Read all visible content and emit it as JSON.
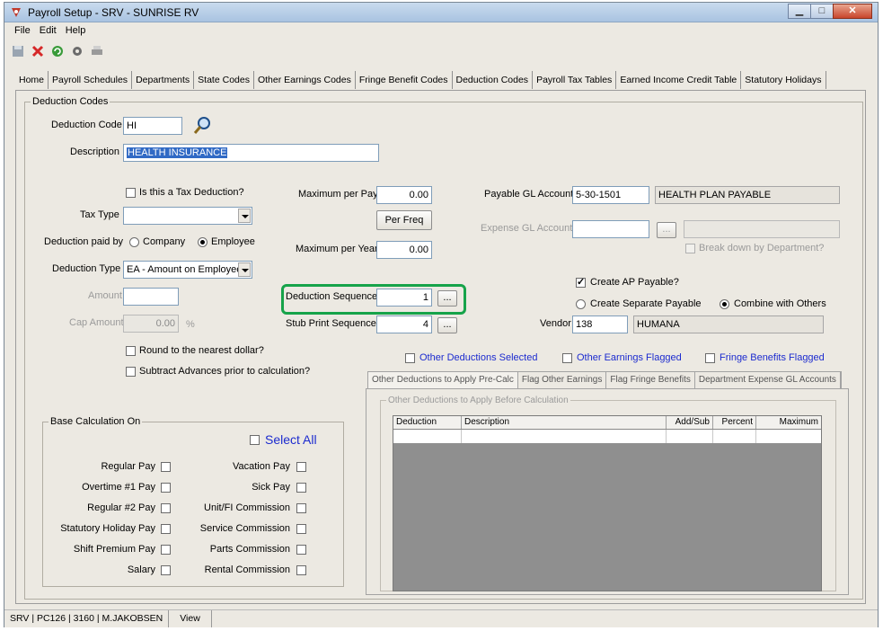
{
  "window": {
    "title": "Payroll Setup - SRV - SUNRISE RV",
    "colors": {
      "accent": "#16a34a",
      "link_blue": "#1c2bcf",
      "selection": "#316ac5"
    }
  },
  "menu": {
    "items": [
      "File",
      "Edit",
      "Help"
    ]
  },
  "toolbar": {
    "icons": [
      "save-icon",
      "delete-icon",
      "refresh-icon",
      "settings-icon",
      "print-icon"
    ]
  },
  "tabs": [
    "Home",
    "Payroll Schedules",
    "Departments",
    "State Codes",
    "Other Earnings Codes",
    "Fringe Benefit Codes",
    "Deduction Codes",
    "Payroll Tax Tables",
    "Earned Income Credit Table",
    "Statutory Holidays"
  ],
  "active_tab": "Deduction Codes",
  "deduction_codes": {
    "group_title": "Deduction Codes",
    "code_label": "Deduction Code",
    "code_value": "HI",
    "description_label": "Description",
    "description_value": "HEALTH INSURANCE",
    "tax_deduction_label": "Is this a Tax Deduction?",
    "tax_type_label": "Tax Type",
    "tax_type_value": "",
    "paid_by_label": "Deduction paid by",
    "paid_by_company": "Company",
    "paid_by_employee": "Employee",
    "type_label": "Deduction Type",
    "type_value": "EA - Amount on Employees",
    "amount_label": "Amount",
    "amount_value": "",
    "cap_amount_label": "Cap Amount",
    "cap_amount_value": "0.00",
    "percent_sign": "%",
    "round_label": "Round to the nearest dollar?",
    "subtract_label": "Subtract Advances prior to calculation?",
    "max_per_pay_label": "Maximum per Pay",
    "max_per_pay_value": "0.00",
    "per_freq_button": "Per Freq",
    "max_per_year_label": "Maximum per Year",
    "max_per_year_value": "0.00",
    "sequence_label": "Deduction Sequence",
    "sequence_value": "1",
    "stub_label": "Stub Print Sequence",
    "stub_value": "4",
    "ellipsis": "...",
    "payable_gl_label": "Payable GL Account",
    "payable_gl_value": "5-30-1501",
    "payable_gl_desc": "HEALTH PLAN PAYABLE",
    "expense_gl_label": "Expense GL Account",
    "expense_gl_value": "",
    "expense_gl_desc": "",
    "break_down_label": "Break down by Department?",
    "create_ap_label": "Create AP Payable?",
    "separate_label": "Create Separate Payable",
    "combine_label": "Combine with Others",
    "vendor_label": "Vendor",
    "vendor_value": "138",
    "vendor_name": "HUMANA",
    "other_deductions_selected": "Other Deductions Selected",
    "other_earnings_flagged": "Other Earnings Flagged",
    "fringe_flagged": "Fringe Benefits Flagged"
  },
  "sub_tabs": [
    "Other Deductions to Apply Pre-Calc",
    "Flag Other Earnings",
    "Flag Fringe Benefits",
    "Department Expense GL Accounts"
  ],
  "pre_calc": {
    "group_title": "Other Deductions to Apply Before Calculation",
    "columns": [
      "Deduction",
      "Description",
      "Add/Sub",
      "Percent",
      "Maximum"
    ]
  },
  "base_calc": {
    "group_title": "Base Calculation On",
    "select_all": "Select All",
    "left_items": [
      "Regular Pay",
      "Overtime #1 Pay",
      "Regular #2 Pay",
      "Statutory Holiday Pay",
      "Shift Premium Pay",
      "Salary"
    ],
    "right_items": [
      "Vacation Pay",
      "Sick Pay",
      "Unit/FI Commission",
      "Service Commission",
      "Parts Commission",
      "Rental Commission"
    ]
  },
  "status": {
    "session": "SRV | PC126 | 3160 | M.JAKOBSEN",
    "view": "View"
  }
}
